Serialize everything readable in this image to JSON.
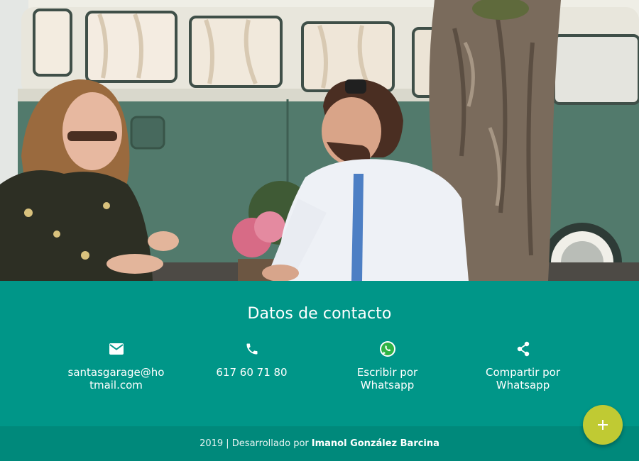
{
  "hero": {
    "image_description_icon": "photo"
  },
  "contact": {
    "title": "Datos de contacto",
    "items": [
      {
        "icon": "email-icon",
        "label": "santasgarage@hotmail.com"
      },
      {
        "icon": "phone-icon",
        "label": "617 60 71 80"
      },
      {
        "icon": "whatsapp-icon",
        "label": "Escribir por Whatsapp"
      },
      {
        "icon": "share-icon",
        "label": "Compartir por Whatsapp"
      }
    ],
    "background_color": "#009688"
  },
  "footer": {
    "prefix": "2019 | Desarrollado por",
    "author": "Imanol González Barcina",
    "background_color": "#00897b"
  },
  "fab": {
    "icon": "plus-icon",
    "color": "#c0ca33"
  }
}
